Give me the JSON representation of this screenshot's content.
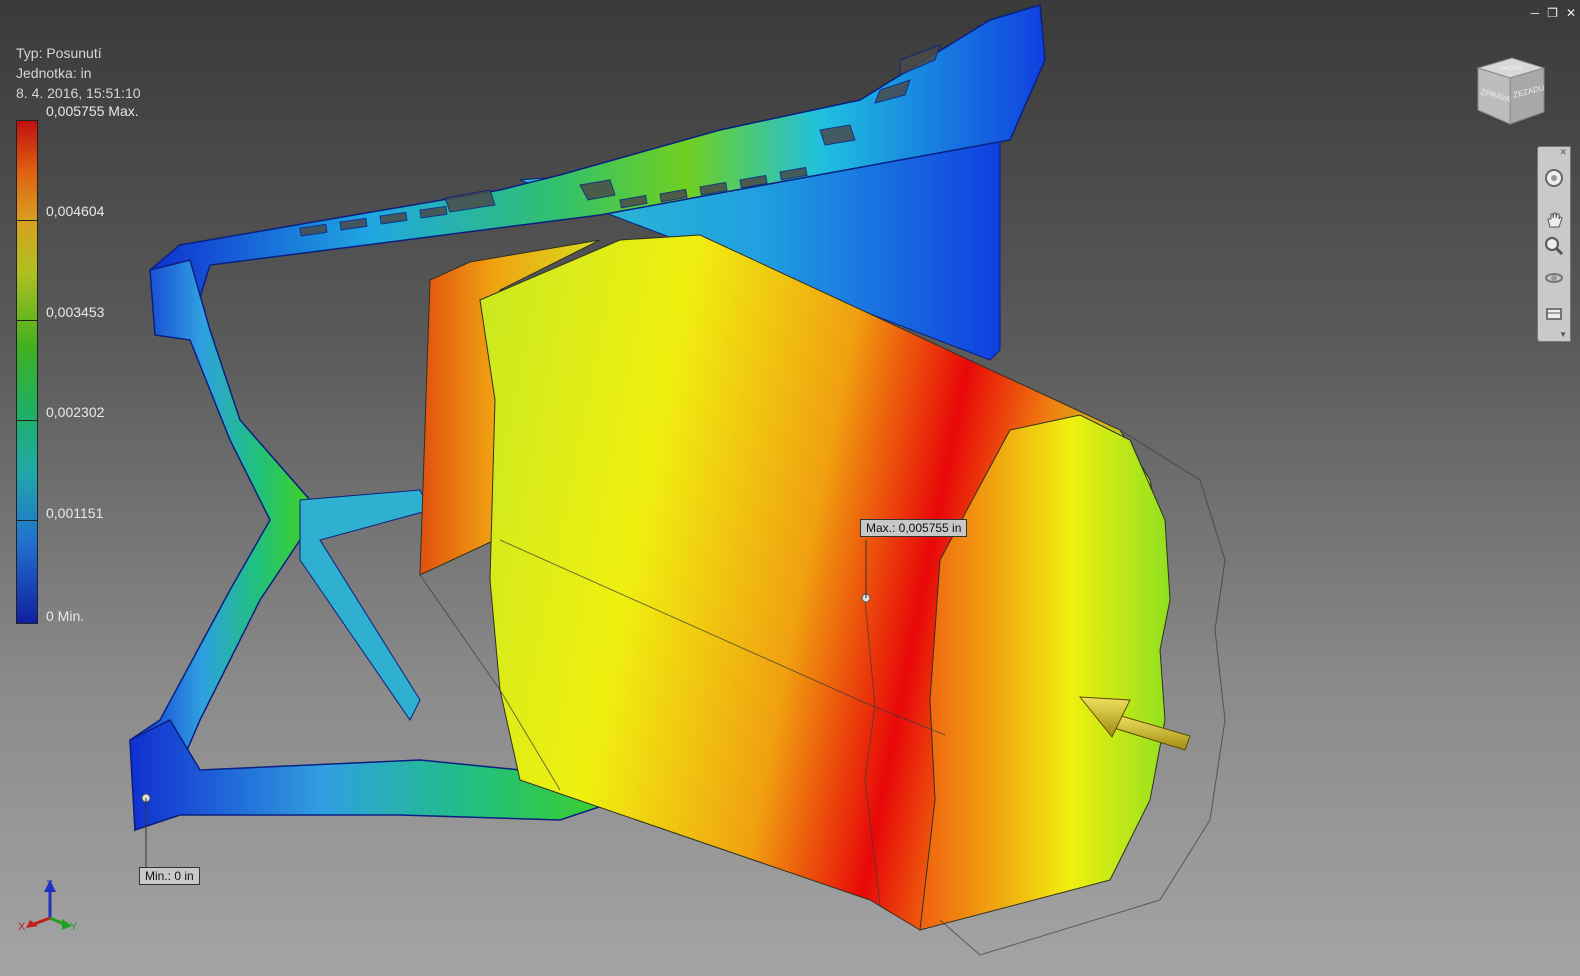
{
  "result_info": {
    "type_line": "Typ: Posunutí",
    "unit_line": "Jednotka: in",
    "date_line": "8. 4. 2016, 15:51:10"
  },
  "legend": {
    "labels": [
      "0,005755 Max.",
      "0,004604",
      "0,003453",
      "0,002302",
      "0,001151",
      "0 Min."
    ],
    "max_value": 0.005755,
    "min_value": 0,
    "unit": "in",
    "colors": [
      "#c01010",
      "#e06010",
      "#d8a020",
      "#40b020",
      "#20a8a8",
      "#1020a0"
    ]
  },
  "callouts": {
    "max": "Max.: 0,005755 in",
    "min": "Min.: 0 in"
  },
  "viewcube": {
    "face_left": "ZPRAVA",
    "face_right": "ZEZADU",
    "face_top": "SHORA"
  },
  "window_controls": [
    "minimize-icon",
    "restore-icon",
    "close-icon"
  ],
  "nav_bar": [
    "steering-wheel-icon",
    "pan-icon",
    "zoom-icon",
    "orbit-icon",
    "look-at-icon"
  ],
  "axis_triad": {
    "x": "X",
    "y": "Y",
    "z": "Z"
  }
}
